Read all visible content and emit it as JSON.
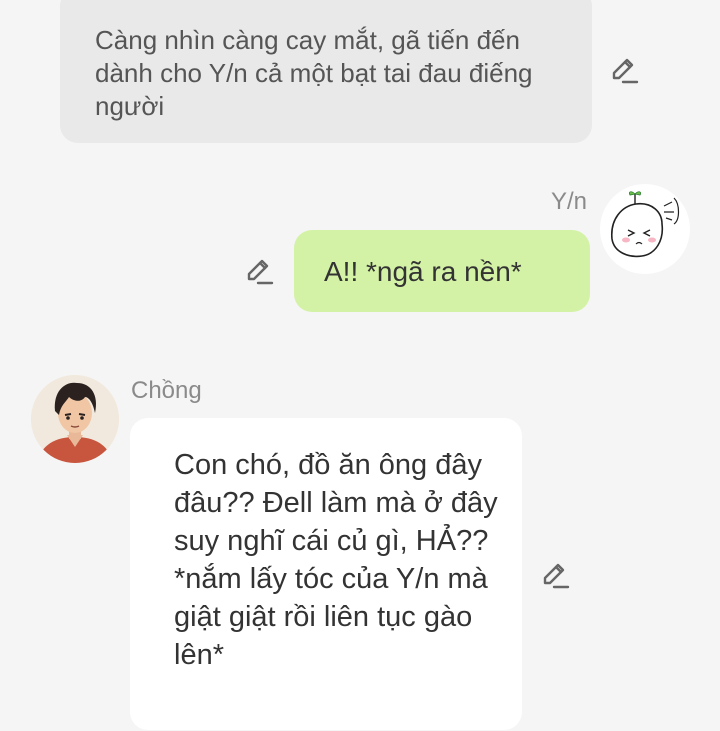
{
  "messages": {
    "narration": {
      "text": "Càng nhìn càng cay mắt, gã tiến đến dành cho Y/n cả một bạt tai đau điếng người"
    },
    "user": {
      "sender": "Y/n",
      "text": "A!! *ngã ra nền*",
      "bubble_color": "#d3f2a6",
      "avatar_icon": "doodle-avatar-icon"
    },
    "character": {
      "sender": "Chồng",
      "text": "Con chó, đồ ăn ông đây đâu?? Đell làm mà ở đây suy nghĩ cái củ gì, HẢ?? *nắm lấy tóc của Y/n mà giật giật rồi liên tục gào lên*",
      "bubble_color": "#ffffff",
      "avatar_icon": "anime-character-avatar-icon"
    }
  },
  "icons": {
    "edit": "pencil-edit-icon"
  },
  "colors": {
    "background": "#f5f5f5",
    "narration_bubble": "#e9e9e9",
    "name_text": "#8a8a8a"
  }
}
